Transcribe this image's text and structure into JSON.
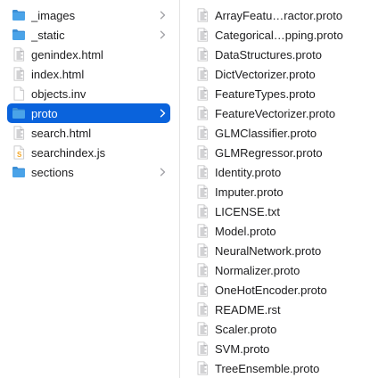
{
  "colors": {
    "selection": "#0a63dc",
    "folder": "#4aa3e8",
    "folder_tab": "#3c8fd6",
    "chevron": "#a3a3a8",
    "doc_outline": "#c6c6c8"
  },
  "left_column": {
    "items": [
      {
        "label": "_images",
        "kind": "folder",
        "icon": "folder-icon",
        "has_children": true,
        "selected": false
      },
      {
        "label": "_static",
        "kind": "folder",
        "icon": "folder-icon",
        "has_children": true,
        "selected": false
      },
      {
        "label": "genindex.html",
        "kind": "file",
        "icon": "html-file-icon",
        "has_children": false,
        "selected": false
      },
      {
        "label": "index.html",
        "kind": "file",
        "icon": "html-file-icon",
        "has_children": false,
        "selected": false
      },
      {
        "label": "objects.inv",
        "kind": "file",
        "icon": "blank-file-icon",
        "has_children": false,
        "selected": false
      },
      {
        "label": "proto",
        "kind": "folder",
        "icon": "folder-icon",
        "has_children": true,
        "selected": true
      },
      {
        "label": "search.html",
        "kind": "file",
        "icon": "html-file-icon",
        "has_children": false,
        "selected": false
      },
      {
        "label": "searchindex.js",
        "kind": "file",
        "icon": "js-file-icon",
        "has_children": false,
        "selected": false
      },
      {
        "label": "sections",
        "kind": "folder",
        "icon": "folder-icon",
        "has_children": true,
        "selected": false
      }
    ]
  },
  "right_column": {
    "items": [
      {
        "label": "ArrayFeatu…ractor.proto",
        "icon": "text-file-icon"
      },
      {
        "label": "Categorical…pping.proto",
        "icon": "text-file-icon"
      },
      {
        "label": "DataStructures.proto",
        "icon": "text-file-icon"
      },
      {
        "label": "DictVectorizer.proto",
        "icon": "text-file-icon"
      },
      {
        "label": "FeatureTypes.proto",
        "icon": "text-file-icon"
      },
      {
        "label": "FeatureVectorizer.proto",
        "icon": "text-file-icon"
      },
      {
        "label": "GLMClassifier.proto",
        "icon": "text-file-icon"
      },
      {
        "label": "GLMRegressor.proto",
        "icon": "text-file-icon"
      },
      {
        "label": "Identity.proto",
        "icon": "text-file-icon"
      },
      {
        "label": "Imputer.proto",
        "icon": "text-file-icon"
      },
      {
        "label": "LICENSE.txt",
        "icon": "text-file-icon"
      },
      {
        "label": "Model.proto",
        "icon": "text-file-icon"
      },
      {
        "label": "NeuralNetwork.proto",
        "icon": "text-file-icon"
      },
      {
        "label": "Normalizer.proto",
        "icon": "text-file-icon"
      },
      {
        "label": "OneHotEncoder.proto",
        "icon": "text-file-icon"
      },
      {
        "label": "README.rst",
        "icon": "text-file-icon"
      },
      {
        "label": "Scaler.proto",
        "icon": "text-file-icon"
      },
      {
        "label": "SVM.proto",
        "icon": "text-file-icon"
      },
      {
        "label": "TreeEnsemble.proto",
        "icon": "text-file-icon"
      }
    ]
  }
}
